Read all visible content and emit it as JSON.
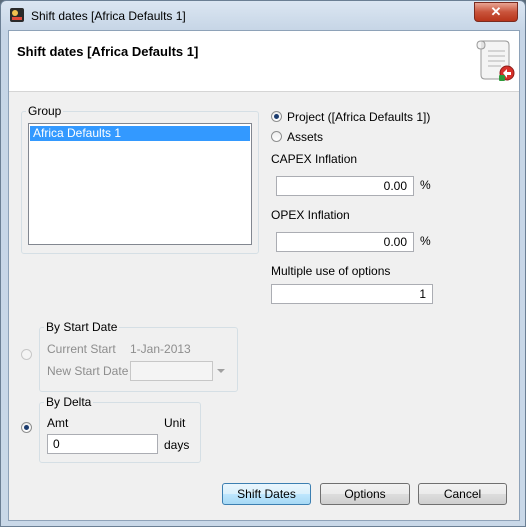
{
  "window": {
    "title": "Shift dates [Africa Defaults 1]",
    "close_label": "✕"
  },
  "header": {
    "title": "Shift dates [Africa Defaults 1]"
  },
  "group": {
    "legend": "Group",
    "items": [
      "Africa Defaults 1"
    ],
    "selected": "Africa Defaults 1"
  },
  "scope": {
    "project_label": "Project ([Africa Defaults 1])",
    "assets_label": "Assets",
    "selected": "project"
  },
  "capex": {
    "label": "CAPEX Inflation",
    "value": "0.00",
    "unit": "%"
  },
  "opex": {
    "label": "OPEX Inflation",
    "value": "0.00",
    "unit": "%"
  },
  "multiple": {
    "label": "Multiple use of options",
    "value": "1"
  },
  "by_start_date": {
    "legend": "By Start Date",
    "current_start_label": "Current Start",
    "current_start_value": "1-Jan-2013",
    "new_start_label": "New Start Date",
    "new_start_value": "",
    "enabled": false
  },
  "by_delta": {
    "legend": "By Delta",
    "amt_label": "Amt",
    "unit_label": "Unit",
    "amt_value": "0",
    "unit_value": "days",
    "enabled": true
  },
  "buttons": {
    "shift_dates": "Shift Dates",
    "options": "Options",
    "cancel": "Cancel"
  },
  "colors": {
    "selection": "#3399ff",
    "close_button": "#c9543b"
  }
}
